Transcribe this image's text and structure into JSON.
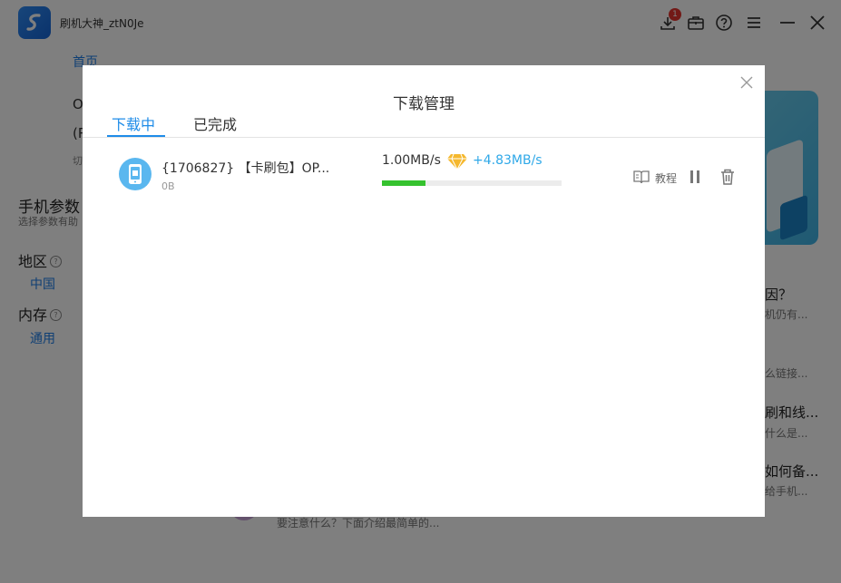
{
  "app": {
    "title": "刷机大神_ztN0Je",
    "download_badge": "1",
    "nav_home": "首页"
  },
  "background": {
    "partial_o": "O",
    "partial_r": "(R",
    "partial_qie": "切",
    "phone_params_title": "手机参数",
    "phone_params_sub": "选择参数有助",
    "region_label": "地区",
    "region_value": "中国",
    "memory_label": "内存",
    "memory_value": "通用",
    "faq": [
      {
        "title": "因？",
        "desc": "机仍有..."
      },
      {
        "title": "",
        "desc": "么链接..."
      },
      {
        "title": "刷和线...",
        "desc": "什么是..."
      },
      {
        "title": "如何备...",
        "desc": "给手机..."
      }
    ],
    "bottom_desc": "要注意什么？下面介绍最简单的..."
  },
  "modal": {
    "title": "下载管理",
    "tabs": [
      {
        "label": "下载中",
        "active": true
      },
      {
        "label": "已完成",
        "active": false
      }
    ],
    "downloads": [
      {
        "name": "{1706827} 【卡刷包】OP...",
        "size": "0B",
        "speed": "1.00MB/s",
        "boost": "+4.83MB/s",
        "progress": 0.24,
        "tutorial_label": "教程"
      }
    ]
  },
  "colors": {
    "accent": "#1f8ce8",
    "progress": "#35c22e",
    "vip_gold": "#f5b82e",
    "badge_red": "#e5322d"
  }
}
